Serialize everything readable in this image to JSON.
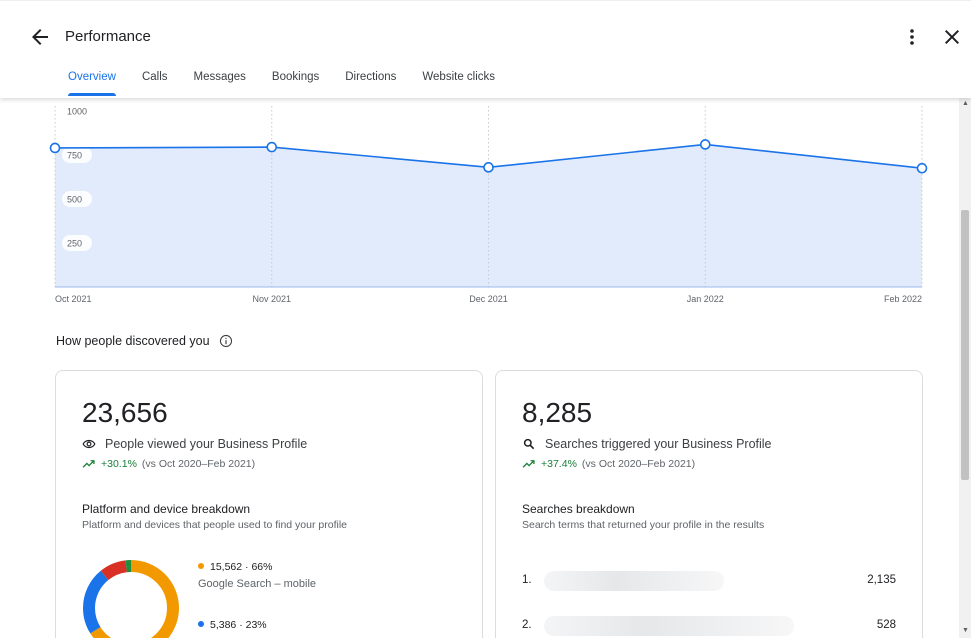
{
  "header": {
    "title": "Performance",
    "tabs": [
      {
        "label": "Overview",
        "active": true
      },
      {
        "label": "Calls"
      },
      {
        "label": "Messages"
      },
      {
        "label": "Bookings"
      },
      {
        "label": "Directions"
      },
      {
        "label": "Website clicks"
      }
    ],
    "icons": {
      "back": "arrow-back-icon",
      "more": "more-vert-icon",
      "close": "close-icon"
    }
  },
  "chart_data": {
    "type": "area",
    "categories": [
      "Oct 2021",
      "Nov 2021",
      "Dec 2021",
      "Jan 2022",
      "Feb 2022"
    ],
    "values": [
      790,
      795,
      680,
      810,
      675
    ],
    "yticks": [
      "1000",
      "750",
      "500",
      "250"
    ],
    "ylim": [
      0,
      1000
    ],
    "grid": "vertical-dotted",
    "colors": {
      "line": "#1a73e8",
      "fill": "#e1ebfc"
    }
  },
  "discovery": {
    "section_title": "How people discovered you",
    "views_card": {
      "number": "23,656",
      "label": "People viewed your Business Profile",
      "change": "+30.1%",
      "compare": "(vs Oct 2020–Feb 2021)",
      "breakdown_title": "Platform and device breakdown",
      "breakdown_desc": "Platform and devices that people used to find your profile",
      "legend": [
        {
          "value": "15,562 · 66%",
          "label": "Google Search – mobile",
          "color": "#f29900"
        },
        {
          "value": "5,386 · 23%",
          "label": "",
          "color": "#1a73e8"
        }
      ],
      "donut_segments": [
        {
          "fraction": 0.66,
          "color": "#f29900"
        },
        {
          "fraction": 0.23,
          "color": "#1a73e8"
        },
        {
          "fraction": 0.09,
          "color": "#d93025"
        },
        {
          "fraction": 0.02,
          "color": "#1e8e3e"
        }
      ]
    },
    "searches_card": {
      "number": "8,285",
      "label": "Searches triggered your Business Profile",
      "change": "+37.4%",
      "compare": "(vs Oct 2020–Feb 2021)",
      "breakdown_title": "Searches breakdown",
      "breakdown_desc": "Search terms that returned your profile in the results",
      "rows": [
        {
          "rank": "1.",
          "count": "2,135"
        },
        {
          "rank": "2.",
          "count": "528"
        }
      ]
    }
  },
  "colors": {
    "accent": "#1a73e8",
    "positive": "#188038"
  }
}
